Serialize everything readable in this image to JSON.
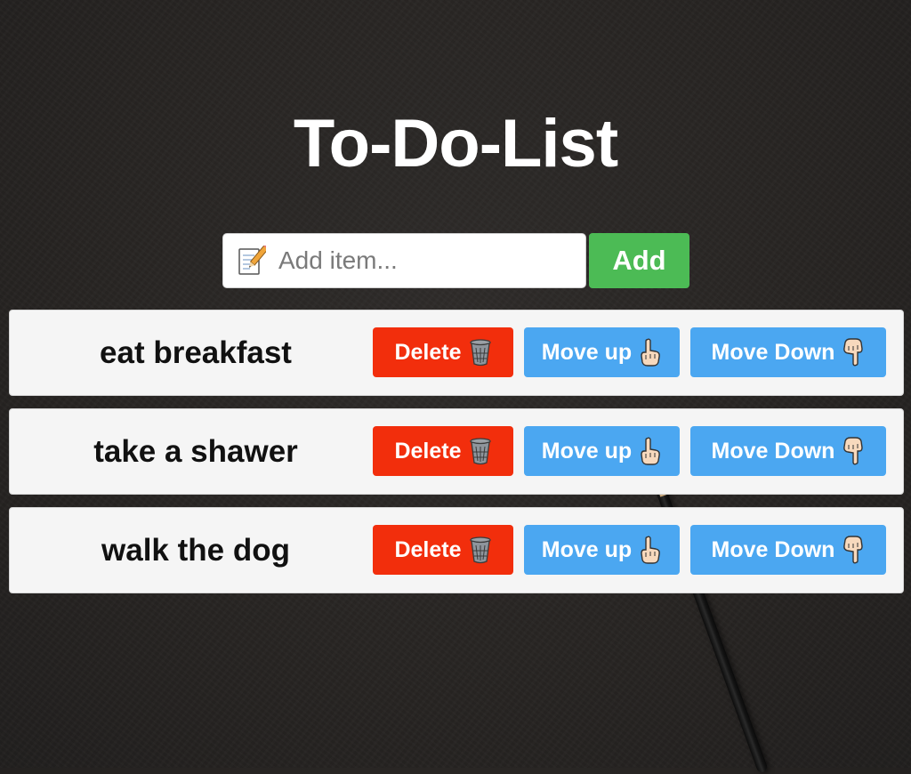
{
  "header": {
    "title": "To-Do-List"
  },
  "add_form": {
    "placeholder": "Add item...",
    "value": "",
    "icon": "memo-pencil-icon",
    "add_label": "Add",
    "add_color": "#4cbb55"
  },
  "todo": {
    "items": [
      {
        "text": "eat breakfast",
        "delete_label": "Delete",
        "move_up_label": "Move up",
        "move_down_label": "Move Down"
      },
      {
        "text": "take a shawer",
        "delete_label": "Delete",
        "move_up_label": "Move up",
        "move_down_label": "Move Down"
      },
      {
        "text": "walk the dog",
        "delete_label": "Delete",
        "move_up_label": "Move up",
        "move_down_label": "Move Down"
      }
    ],
    "icons": {
      "delete": "wastebasket-icon",
      "move_up": "pointing-up-hand-icon",
      "move_down": "pointing-down-hand-icon"
    }
  },
  "colors": {
    "delete": "#f22e0c",
    "move": "#4ba7f1",
    "add": "#4cbb55",
    "title": "#ffffff",
    "background": "#282523"
  }
}
